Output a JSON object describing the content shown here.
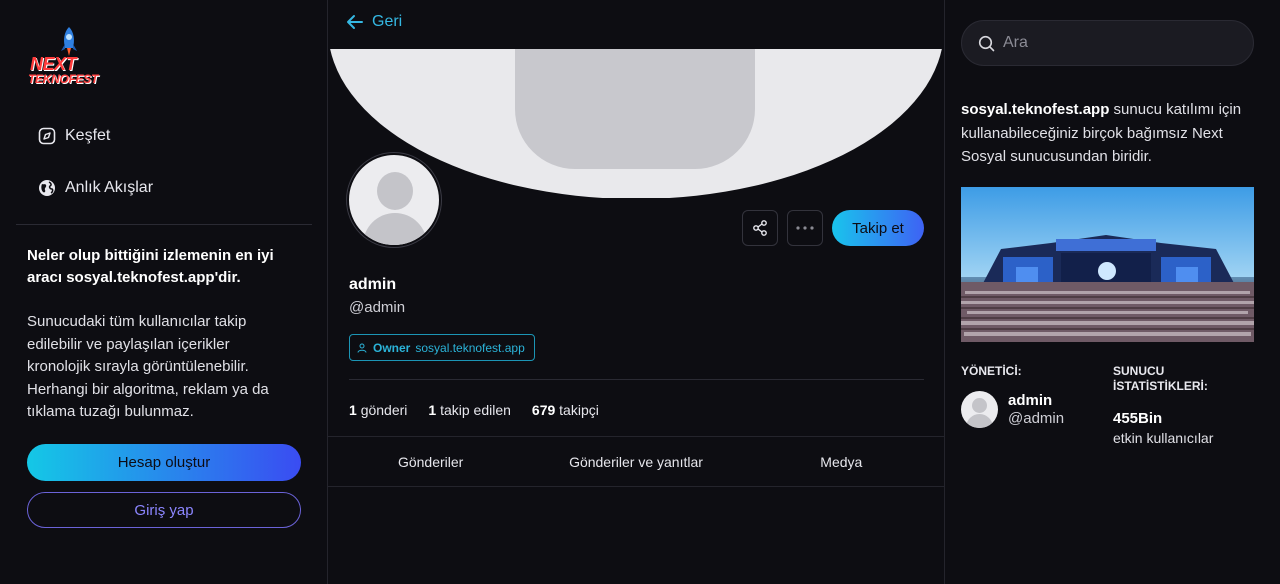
{
  "brand": {
    "logo_line1": "NEXT",
    "logo_line2": "TEKNOFEST"
  },
  "nav": {
    "items": [
      {
        "label": "Keşfet",
        "icon": "compass-icon"
      },
      {
        "label": "Anlık Akışlar",
        "icon": "globe-icon"
      }
    ]
  },
  "intro": {
    "title": "Neler olup bittiğini izlemenin en iyi aracı sosyal.teknofest.app'dir.",
    "body": "Sunucudaki tüm kullanıcılar takip edilebilir ve paylaşılan içerikler kronolojik sırayla görüntülenebilir. Herhangi bir algoritma, reklam ya da tıklama tuzağı bulunmaz."
  },
  "auth": {
    "create_label": "Hesap oluştur",
    "login_label": "Giriş yap"
  },
  "profile": {
    "back_label": "Geri",
    "display_name": "admin",
    "handle": "@admin",
    "role": "Owner",
    "role_domain": "sosyal.teknofest.app",
    "follow_label": "Takip et",
    "stats": [
      {
        "value": "1",
        "label": "gönderi"
      },
      {
        "value": "1",
        "label": "takip edilen"
      },
      {
        "value": "679",
        "label": "takipçi"
      }
    ],
    "tabs": [
      "Gönderiler",
      "Gönderiler ve yanıtlar",
      "Medya"
    ]
  },
  "sidebar": {
    "search_placeholder": "Ara",
    "server_name": "sosyal.teknofest.app",
    "server_desc": " sunucu katılımı için kullanabileceğiniz birçok bağımsız Next Sosyal sunucusundan biridir.",
    "admin_label": "YÖNETİCİ:",
    "admin_name": "admin",
    "admin_handle": "@admin",
    "stats_label": "SUNUCU İSTATİSTİKLERİ:",
    "stats_value": "455Bin",
    "stats_caption": "etkin kullanıcılar"
  },
  "colors": {
    "accent": "#35b8e3",
    "gradient_start": "#14c8e6",
    "gradient_end": "#3a4cf2",
    "background": "#0d0d12"
  }
}
